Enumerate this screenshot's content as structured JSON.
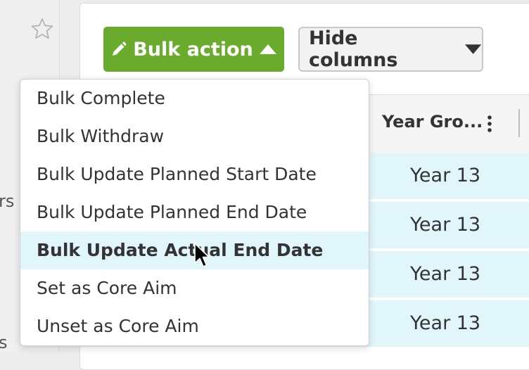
{
  "sidebar": {
    "icon": "star-icon",
    "fragments": [
      "rs",
      "s"
    ]
  },
  "toolbar": {
    "bulk_action_label": "Bulk action",
    "bulk_action_icon": "pencil-icon",
    "hide_columns_label": "Hide columns"
  },
  "table": {
    "column_header": "Year Gro...",
    "rows": [
      "Year 13",
      "Year 13",
      "Year 13",
      "Year 13"
    ]
  },
  "menu": {
    "items": [
      "Bulk Complete",
      "Bulk Withdraw",
      "Bulk Update Planned Start Date",
      "Bulk Update Planned End Date",
      "Bulk Update Actual End Date",
      "Set as Core Aim",
      "Unset as Core Aim"
    ],
    "highlighted_index": 4
  },
  "colors": {
    "bulk_button": "#6aaa2c",
    "row_highlight": "#e0f6fb",
    "menu_hover": "#e0f6fb"
  }
}
